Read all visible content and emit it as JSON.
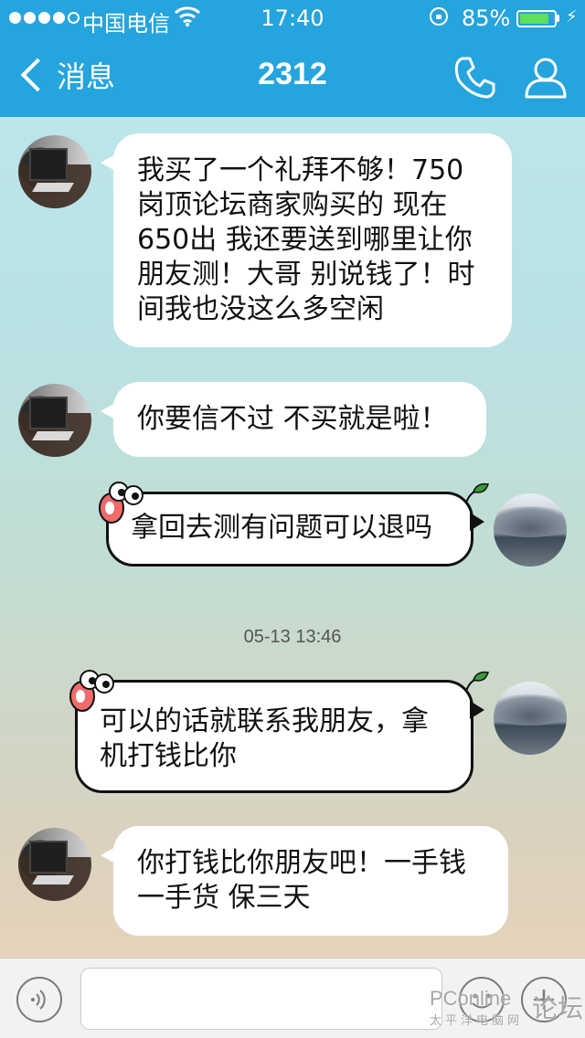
{
  "status_bar": {
    "carrier": "中国电信",
    "time": "17:40",
    "battery_percent": "85%",
    "battery_level": 0.85,
    "signal_bars_filled": 4,
    "signal_bars_total": 5
  },
  "nav": {
    "back_label": "消息",
    "title": "2312",
    "icons": [
      "phone-icon",
      "person-icon"
    ],
    "color": "#25a4dd"
  },
  "messages": [
    {
      "side": "left",
      "avatar": "room-avatar",
      "text": "我买了一个礼拜不够！750岗顶论坛商家购买的 现在650出 我还要送到哪里让你朋友测！大哥 别说钱了！时间我也没这么多空闲"
    },
    {
      "side": "left",
      "avatar": "room-avatar",
      "text": "你要信不过 不买就是啦！"
    },
    {
      "side": "right",
      "avatar": "sky-avatar",
      "text": "拿回去测有问题可以退吗"
    },
    {
      "side": "right",
      "avatar": "sky-avatar",
      "text": "可以的话就联系我朋友，拿机打钱比你"
    },
    {
      "side": "left",
      "avatar": "room-avatar",
      "text": "你打钱比你朋友吧！一手钱一手货 保三天"
    }
  ],
  "timestamp": "05-13 13:46",
  "input_bar": {
    "placeholder": "",
    "value": "",
    "icons": [
      "voice-icon",
      "emoji-icon",
      "plus-icon"
    ]
  },
  "watermark": {
    "brand": "PConline",
    "sub": "太平洋电脑网",
    "suffix": "论坛"
  }
}
